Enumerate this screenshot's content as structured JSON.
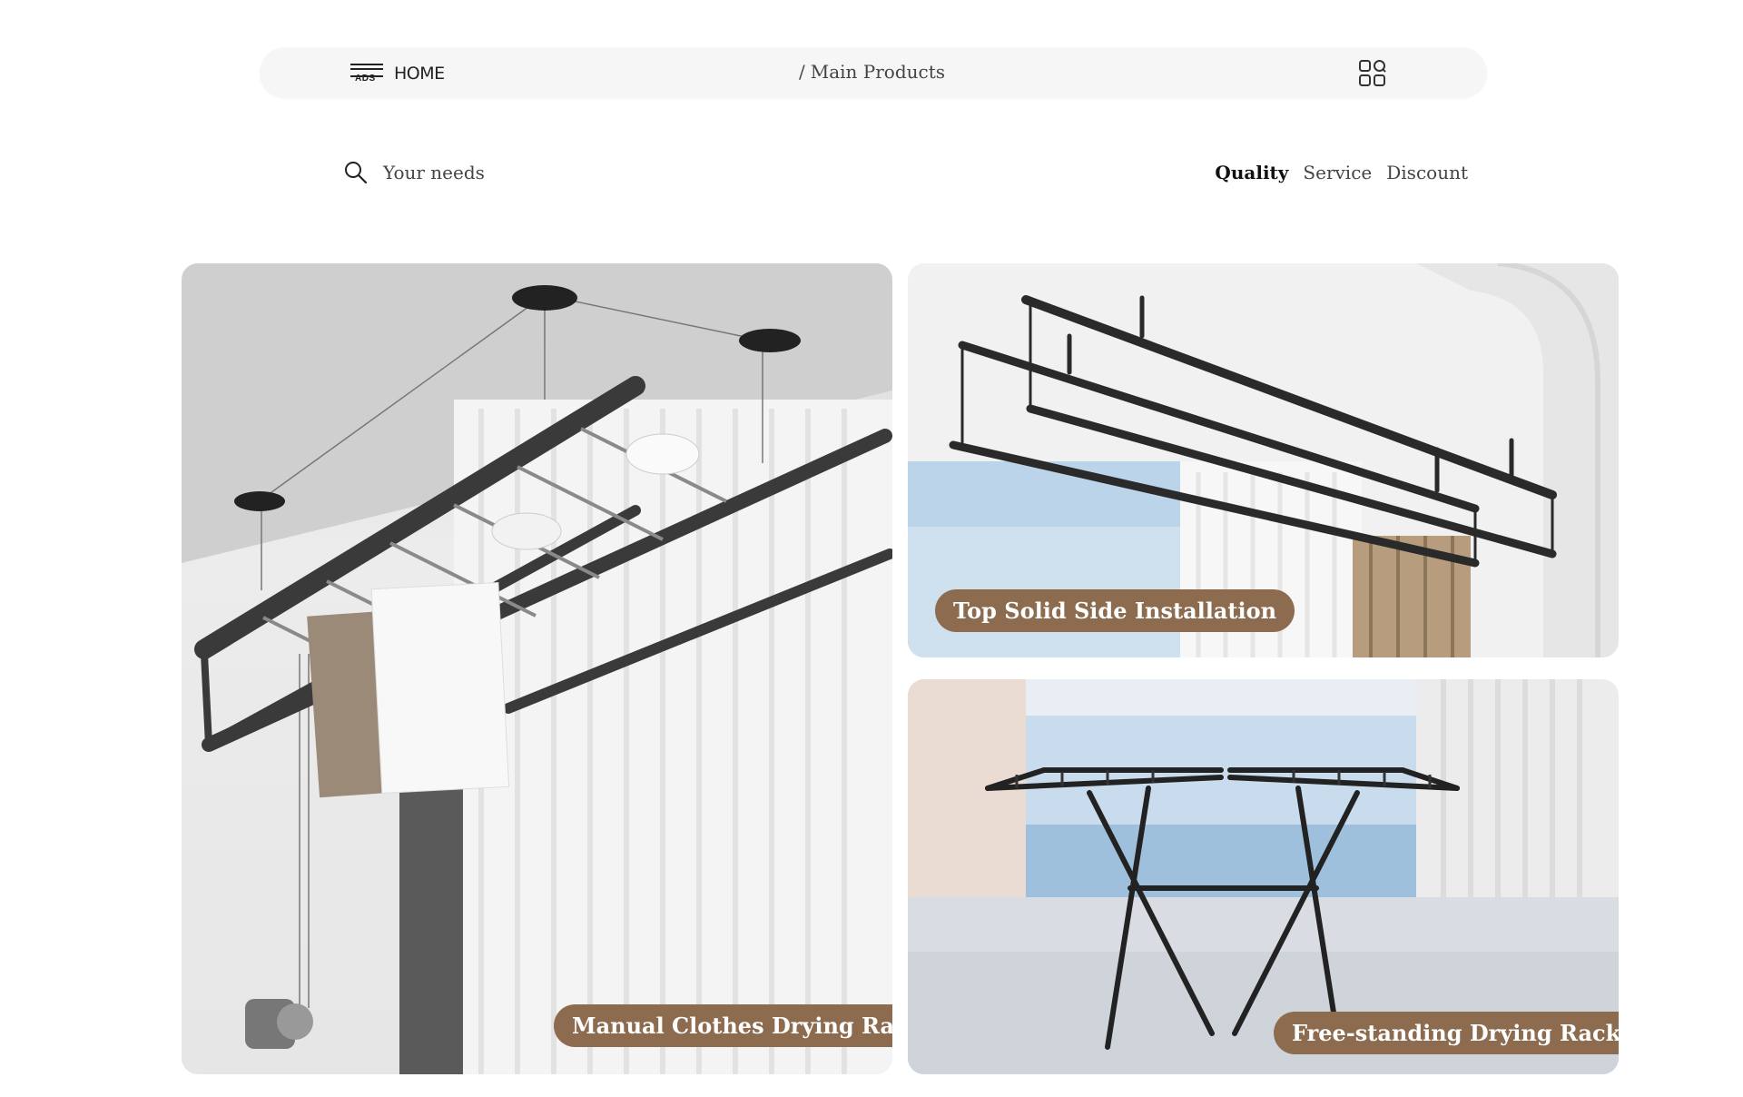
{
  "header": {
    "logo_text": "ADS",
    "home_label": "HOME",
    "breadcrumb_separator": "/",
    "breadcrumb_current": "Main Products",
    "menu_icon": "grid-apps-icon"
  },
  "search": {
    "icon": "search-icon",
    "placeholder": "Your needs"
  },
  "filters": {
    "items": [
      "Quality",
      "Service",
      "Discount"
    ],
    "active": "Quality"
  },
  "products": [
    {
      "label": "Manual Clothes Drying Rack"
    },
    {
      "label": "Top Solid Side Installation"
    },
    {
      "label": "Free-standing Drying Rack"
    }
  ],
  "colors": {
    "label_bg": "#8c6b4f",
    "topbar_bg": "#f6f6f6"
  }
}
